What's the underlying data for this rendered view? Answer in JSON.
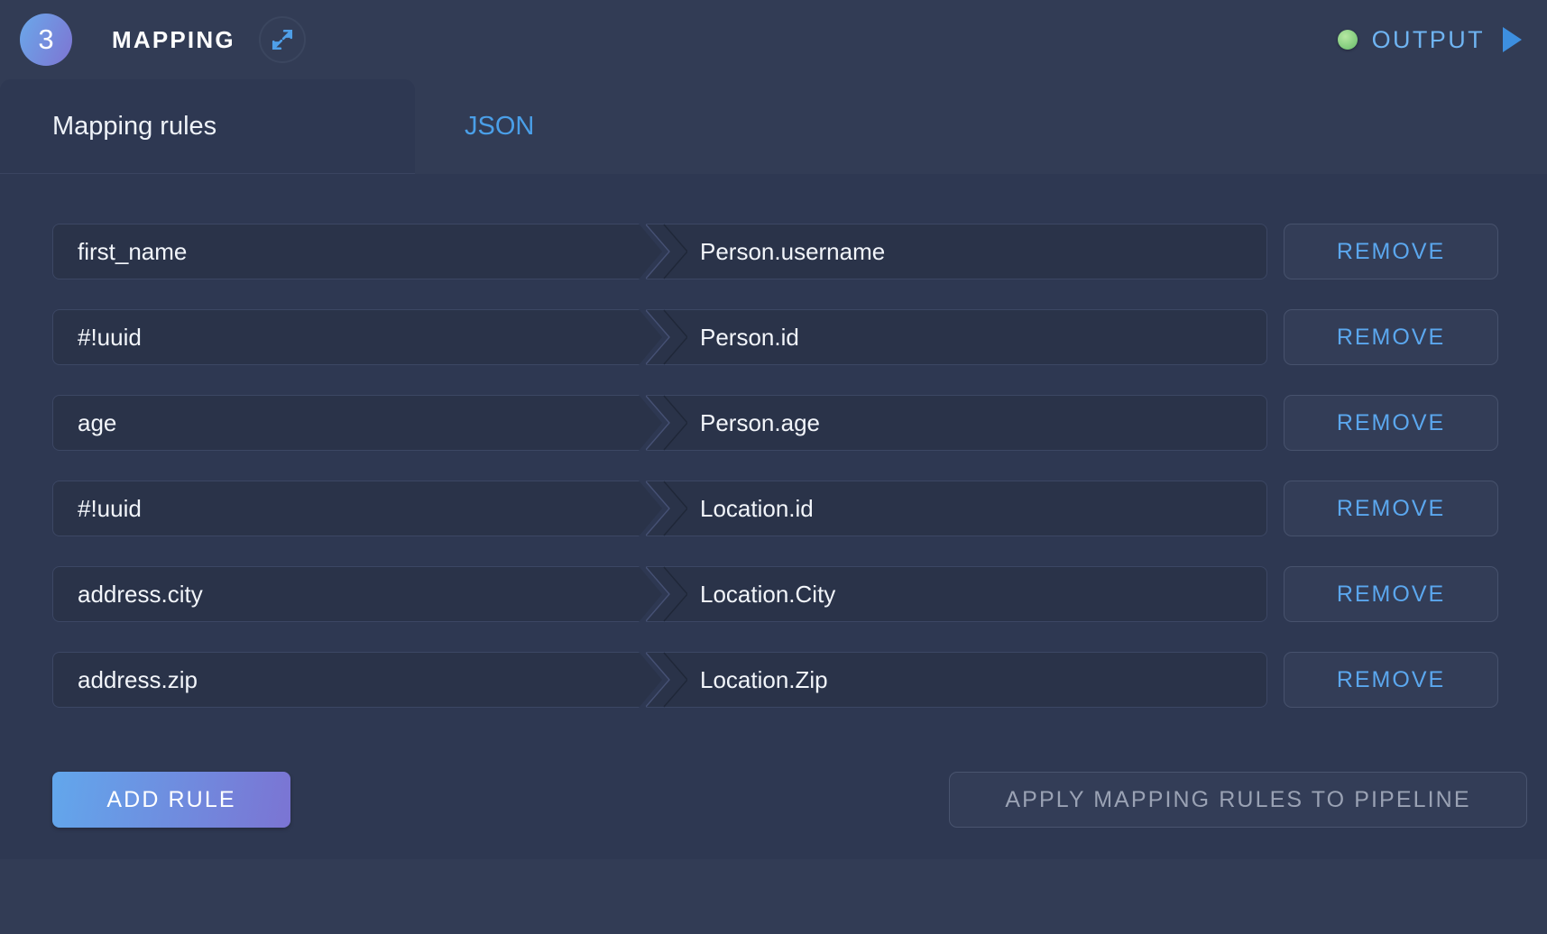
{
  "header": {
    "step_number": "3",
    "title": "MAPPING",
    "expand_icon": "expand-arrows-icon",
    "output_label": "OUTPUT",
    "status_dot_color": "#7ec97a",
    "output_color": "#6fb4f2",
    "play_icon": "play-triangle-icon"
  },
  "tabs": [
    {
      "label": "Mapping rules",
      "active": true
    },
    {
      "label": "JSON",
      "active": false
    }
  ],
  "rules": {
    "remove_label": "REMOVE",
    "items": [
      {
        "source": "first_name",
        "target": "Person.username"
      },
      {
        "source": "#!uuid",
        "target": "Person.id"
      },
      {
        "source": "age",
        "target": "Person.age"
      },
      {
        "source": "#!uuid",
        "target": "Location.id"
      },
      {
        "source": "address.city",
        "target": "Location.City"
      },
      {
        "source": "address.zip",
        "target": "Location.Zip"
      }
    ]
  },
  "footer": {
    "add_rule_label": "ADD RULE",
    "apply_label": "APPLY MAPPING RULES TO PIPELINE"
  },
  "theme": {
    "page_bg": "#323c55",
    "panel_bg": "#2e3852",
    "field_bg": "#2a3349",
    "accent_blue": "#5ba7ee",
    "gradient_start": "#62a7ec",
    "gradient_end": "#7b74d3"
  }
}
